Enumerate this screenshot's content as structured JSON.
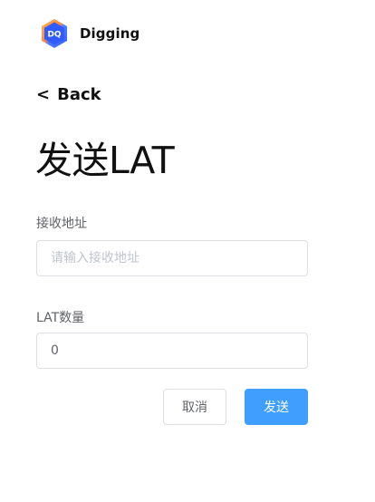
{
  "brand": {
    "name": "Digging",
    "logo_text": "DQ"
  },
  "nav": {
    "back_chevron": "<",
    "back_label": "Back"
  },
  "page": {
    "title": "发送LAT"
  },
  "form": {
    "address": {
      "label": "接收地址",
      "placeholder": "请输入接收地址",
      "value": ""
    },
    "amount": {
      "label": "LAT数量",
      "placeholder": "",
      "value": "0"
    }
  },
  "actions": {
    "cancel_label": "取消",
    "send_label": "发送"
  },
  "colors": {
    "primary": "#409eff",
    "border": "#dcdfe6",
    "label_text": "#606266",
    "placeholder_text": "#c0c4cc",
    "logo_blue": "#2f6bff",
    "logo_orange": "#ff9a3c"
  }
}
